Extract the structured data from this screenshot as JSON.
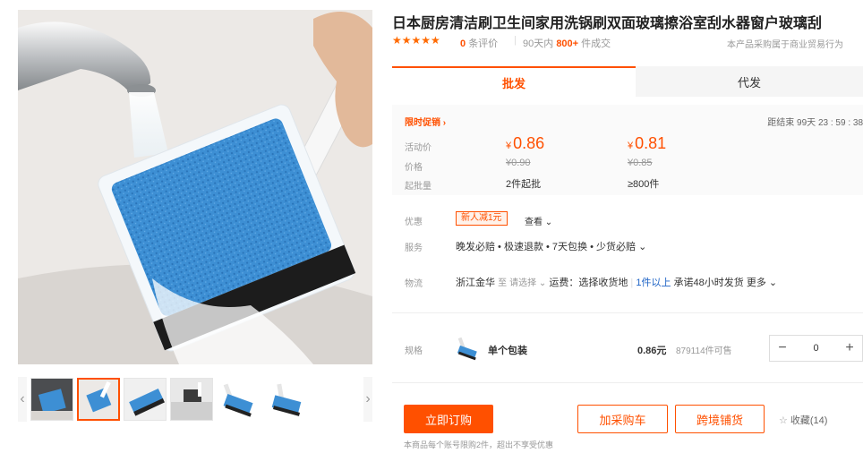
{
  "product": {
    "title": "日本厨房清洁刷卫生间家用洗锅刷双面玻璃擦浴室刮水器窗户玻璃刮",
    "stars": "★★★★★",
    "review_count": "0",
    "review_label": "条评价",
    "sales_prefix": "90天内",
    "sales_count": "800+",
    "sales_suffix": "件成交",
    "notice": "本产品采购属于商业贸易行为"
  },
  "tabs": [
    {
      "label": "批发"
    },
    {
      "label": "代发"
    }
  ],
  "promotion": {
    "title": "限时促销 ›",
    "countdown": "距结束 99天 23 : 59 : 38",
    "labels": {
      "activity": "活动价",
      "price": "价格",
      "moq": "起批量"
    },
    "tiers": [
      {
        "currency": "¥",
        "price": "0.86",
        "original": "¥0.90",
        "moq": "2件起批"
      },
      {
        "currency": "¥",
        "price": "0.81",
        "original": "¥0.85",
        "moq": "≥800件"
      }
    ]
  },
  "offers": {
    "label": "优惠",
    "coupon": "新人减1元",
    "view": "查看 ⌄"
  },
  "service": {
    "label": "服务",
    "text": "晚发必赔 • 极速退款 • 7天包换 • 少货必赔 ⌄"
  },
  "logistics": {
    "label": "物流",
    "origin": "浙江金华",
    "to": "至",
    "select": "请选择 ⌄",
    "freight": "运费：选择收货地",
    "qty": "1件以上",
    "promise": "承诺48小时发货",
    "more": "更多 ⌄"
  },
  "spec": {
    "label": "规格",
    "name": "单个包装",
    "price": "0.86元",
    "stock": "879114件可售",
    "quantity": "0",
    "minus": "−",
    "plus": "+"
  },
  "actions": {
    "order": "立即订购",
    "cart": "加采购车",
    "distribute": "跨境铺货",
    "favorite": "收藏(14)",
    "limit_note": "本商品每个账号限购2件，超出不享受优惠"
  },
  "colors": {
    "accent": "#ff5000",
    "link": "#1f64c6",
    "sponge": "#3a8fd6"
  }
}
